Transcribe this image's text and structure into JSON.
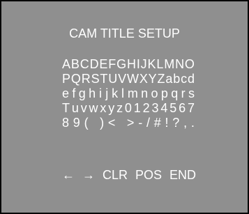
{
  "title": "CAM TITLE SETUP",
  "rows": [
    [
      "A",
      "B",
      "C",
      "D",
      "E",
      "F",
      "G",
      "H",
      "I",
      "J",
      "K",
      "L",
      "M",
      "N",
      "O"
    ],
    [
      "P",
      "Q",
      "R",
      "S",
      "T",
      "U",
      "V",
      "W",
      "X",
      "Y",
      "Z",
      "a",
      "b",
      "c",
      "d"
    ],
    [
      "e",
      "f",
      "g",
      "h",
      "i",
      "j",
      "k",
      "l",
      "m",
      "n",
      "o",
      "p",
      "q",
      "r",
      "s"
    ],
    [
      "T",
      "u",
      "v",
      "w",
      "x",
      "y",
      "z",
      "0",
      "1",
      "2",
      "3",
      "4",
      "5",
      "6",
      "7"
    ],
    [
      "8",
      "9",
      "(",
      "",
      ")",
      "<",
      "",
      ">",
      "-",
      "/",
      "#",
      "!",
      "?",
      ",",
      "."
    ]
  ],
  "controls": {
    "left": "←",
    "right": "→",
    "clear": "CLR",
    "position": "POS",
    "end": "END"
  }
}
